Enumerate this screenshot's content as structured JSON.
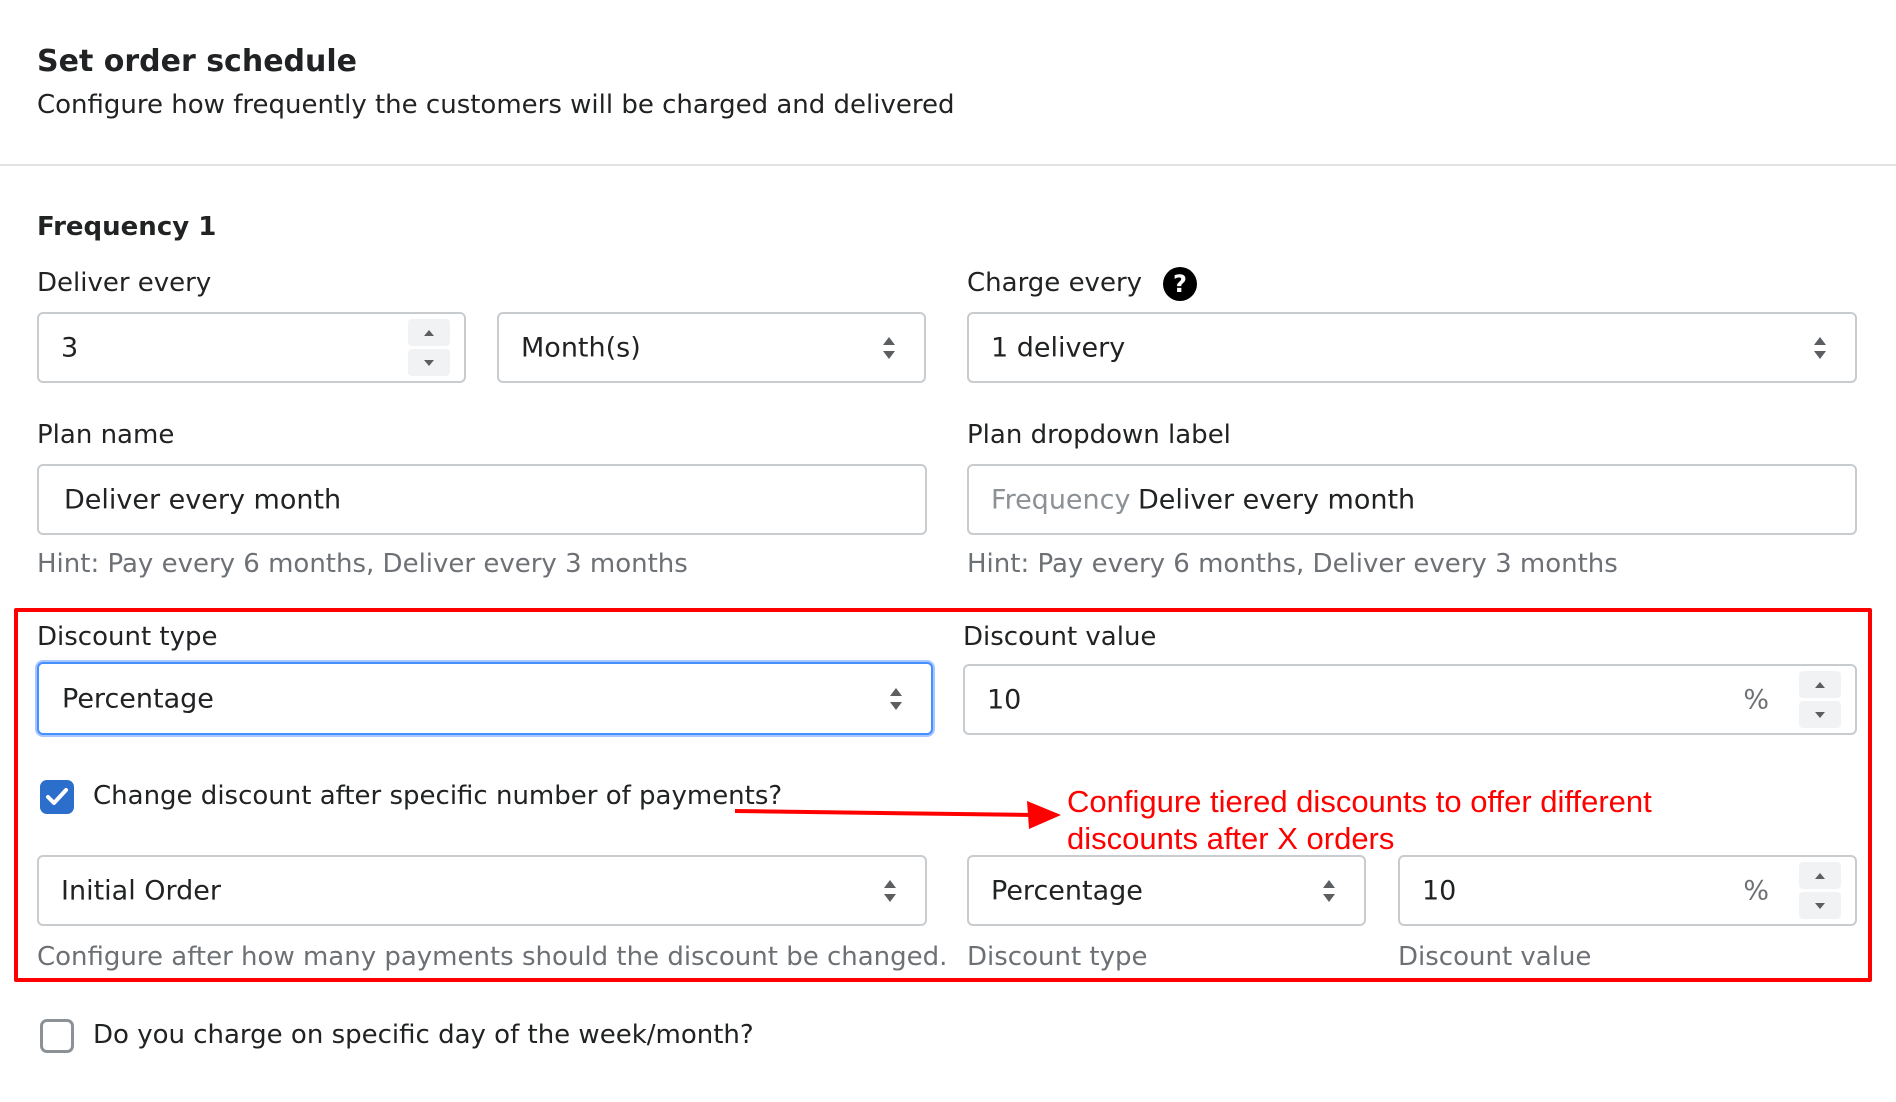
{
  "header": {
    "title": "Set order schedule",
    "subtitle": "Configure how frequently the customers will be charged and delivered"
  },
  "frequency": {
    "title": "Frequency 1",
    "deliver_label": "Deliver every",
    "deliver_value": "3",
    "deliver_unit": "Month(s)",
    "charge_label": "Charge every",
    "help_glyph": "?",
    "charge_value": "1 delivery",
    "plan_name_label": "Plan name",
    "plan_name_value": "Deliver every month",
    "plan_name_hint": "Hint: Pay every 6 months, Deliver every 3 months",
    "dropdown_label": "Plan dropdown label",
    "dropdown_prefix": "Frequency",
    "dropdown_value": "Deliver every month",
    "dropdown_hint": "Hint: Pay every 6 months, Deliver every 3 months"
  },
  "discount": {
    "type_label": "Discount type",
    "type_value": "Percentage",
    "value_label": "Discount value",
    "value_value": "10",
    "value_suffix": "%",
    "change_checkbox_label": "Change discount after specific number of payments?",
    "change_checked": true,
    "tier_order_value": "Initial Order",
    "tier_order_hint": "Configure after how many payments should the discount be changed.",
    "tier_type_value": "Percentage",
    "tier_type_hint": "Discount type",
    "tier_value_value": "10",
    "tier_value_suffix": "%",
    "tier_value_hint": "Discount value"
  },
  "specific_day": {
    "label": "Do you charge on specific day of the week/month?",
    "checked": false
  },
  "annotation": {
    "line1": "Configure tiered discounts to offer different",
    "line2": "discounts after X orders",
    "color": "#ff0000"
  },
  "colors": {
    "accent": "#2c6ecb",
    "focus": "#458fff",
    "hint": "#6d7175",
    "border": "#c9cccf"
  }
}
